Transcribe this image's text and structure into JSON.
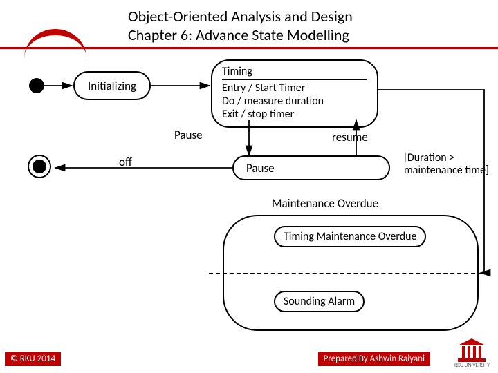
{
  "header": {
    "line1": "Object-Oriented Analysis and Design",
    "line2": "Chapter 6: Advance State Modelling"
  },
  "states": {
    "initializing": "Initializing",
    "timing_title": "Timing",
    "timing_entry": "Entry / Start Timer",
    "timing_do": "Do / measure duration",
    "timing_exit": "Exit / stop timer",
    "pause_state": "Pause",
    "maint_overdue": "Maintenance Overdue",
    "sub_timing": "Timing Maintenance Overdue",
    "sub_alarm": "Sounding Alarm"
  },
  "transitions": {
    "pause": "Pause",
    "resume": "resume",
    "off": "off",
    "guard": "[Duration > maintenance time]"
  },
  "footer": {
    "left": "© RKU 2014",
    "right": "Prepared By Ashwin Raiyani",
    "logo": "RKU UNIVERSITY"
  }
}
